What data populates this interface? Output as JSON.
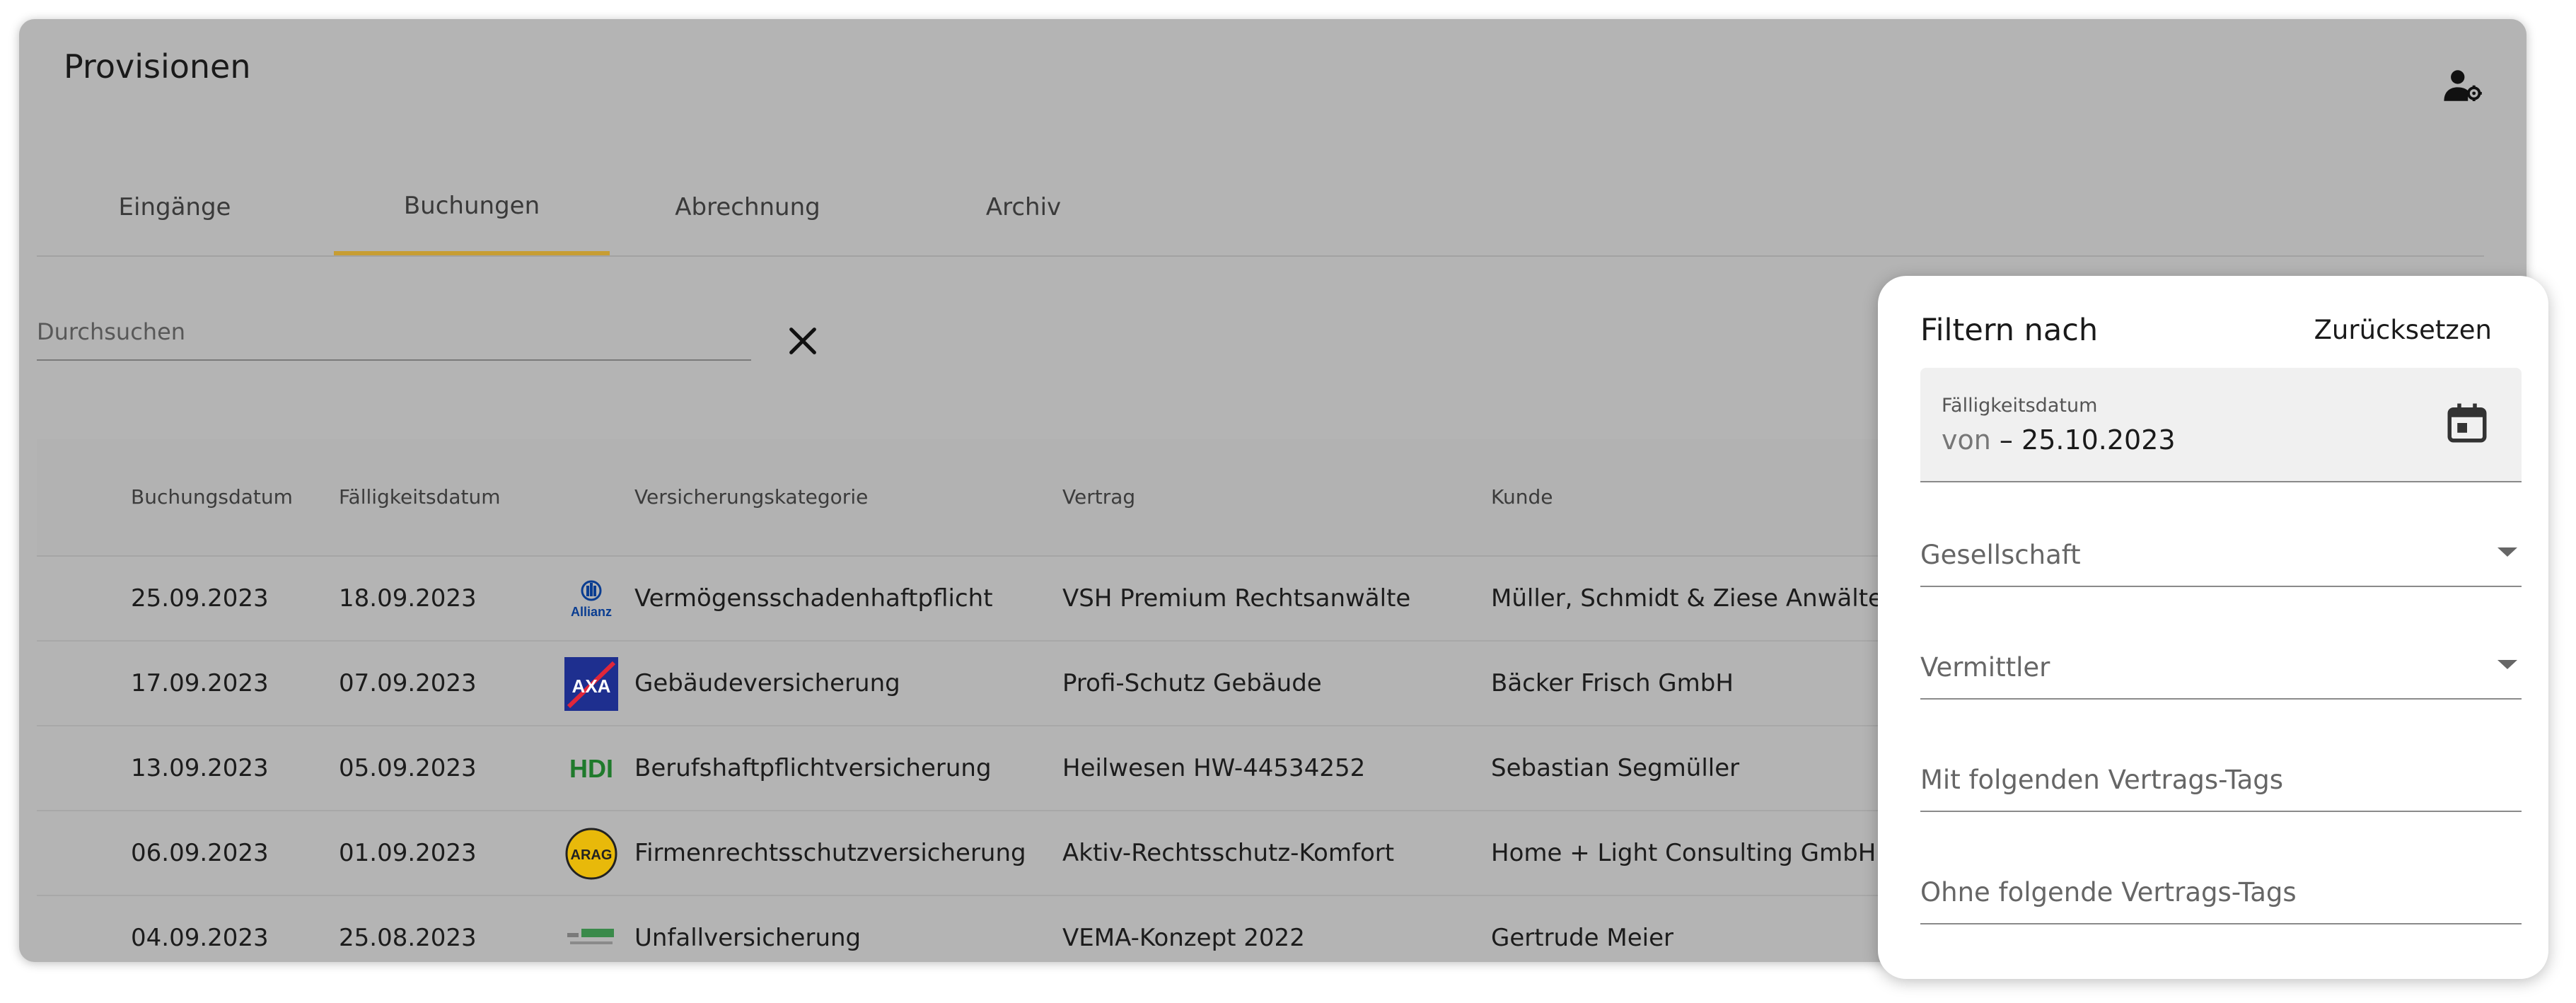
{
  "app": {
    "title": "Provisionen"
  },
  "tabs": [
    {
      "label": "Eingänge",
      "active": false
    },
    {
      "label": "Buchungen",
      "active": true
    },
    {
      "label": "Abrechnung",
      "active": false
    },
    {
      "label": "Archiv",
      "active": false
    }
  ],
  "search": {
    "placeholder": "Durchsuchen",
    "value": ""
  },
  "table": {
    "columns": [
      "Buchungsdatum",
      "Fälligkeitsdatum",
      "Versicherungskategorie",
      "Vertrag",
      "Kunde"
    ],
    "rows": [
      {
        "buchungsdatum": "25.09.2023",
        "faelligkeitsdatum": "18.09.2023",
        "insurer_logo": "allianz-logo",
        "kategorie": "Vermögensschadenhaftpflicht",
        "vertrag": "VSH Premium Rechtsanwälte",
        "kunde": "Müller, Schmidt & Ziese Anwälte"
      },
      {
        "buchungsdatum": "17.09.2023",
        "faelligkeitsdatum": "07.09.2023",
        "insurer_logo": "axa-logo",
        "kategorie": "Gebäudeversicherung",
        "vertrag": "Profi-Schutz Gebäude",
        "kunde": "Bäcker Frisch GmbH"
      },
      {
        "buchungsdatum": "13.09.2023",
        "faelligkeitsdatum": "05.09.2023",
        "insurer_logo": "hdi-logo",
        "kategorie": "Berufshaftpflichtversicherung",
        "vertrag": "Heilwesen HW-44534252",
        "kunde": "Sebastian Segmüller"
      },
      {
        "buchungsdatum": "06.09.2023",
        "faelligkeitsdatum": "01.09.2023",
        "insurer_logo": "arag-logo",
        "kategorie": "Firmenrechtsschutzversicherung",
        "vertrag": "Aktiv-Rechtsschutz-Komfort",
        "kunde": "Home + Light Consulting GmbH"
      },
      {
        "buchungsdatum": "04.09.2023",
        "faelligkeitsdatum": "25.08.2023",
        "insurer_logo": "generic-insurer-logo",
        "kategorie": "Unfallversicherung",
        "vertrag": "VEMA-Konzept 2022",
        "kunde": "Gertrude Meier"
      }
    ]
  },
  "logos": {
    "allianz": "Allianz",
    "axa": "AXA",
    "hdi": "HDI",
    "arag": "ARAG"
  },
  "filter": {
    "title": "Filtern nach",
    "reset_label": "Zurücksetzen",
    "due_date": {
      "label": "Fälligkeitsdatum",
      "from_placeholder": "von",
      "separator": "–",
      "to_value": "25.10.2023"
    },
    "company_label": "Gesellschaft",
    "broker_label": "Vermittler",
    "with_tags_label": "Mit folgenden Vertrags-Tags",
    "without_tags_label": "Ohne folgende Vertrags-Tags"
  },
  "colors": {
    "overlay_background": "#b4b4b4",
    "active_tab_indicator": "#c79d33",
    "panel_background": "#ffffff"
  }
}
